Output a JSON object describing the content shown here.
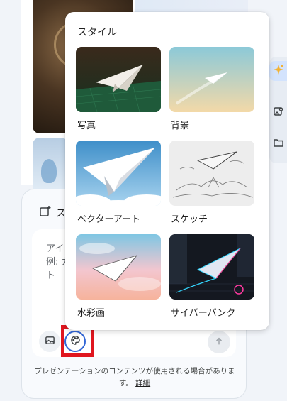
{
  "popup": {
    "title": "スタイル",
    "styles": [
      {
        "label": "写真",
        "icon": "paper-plane-photo"
      },
      {
        "label": "背景",
        "icon": "paper-plane-background"
      },
      {
        "label": "ベクターアート",
        "icon": "paper-plane-vector-art"
      },
      {
        "label": "スケッチ",
        "icon": "paper-plane-sketch"
      },
      {
        "label": "水彩画",
        "icon": "paper-plane-watercolor"
      },
      {
        "label": "サイバーパンク",
        "icon": "paper-plane-cyberpunk"
      }
    ]
  },
  "compose": {
    "header_text": "ス",
    "placeholder": "アイ\n例: カ\nト",
    "disclaimer": "プレゼンテーションのコンテンツが使用される場合があります。",
    "details_link": "詳細"
  },
  "colors": {
    "accent_ring": "#3367d6",
    "highlight_box": "#e0161f",
    "rail_active": "#d3e3fd"
  }
}
